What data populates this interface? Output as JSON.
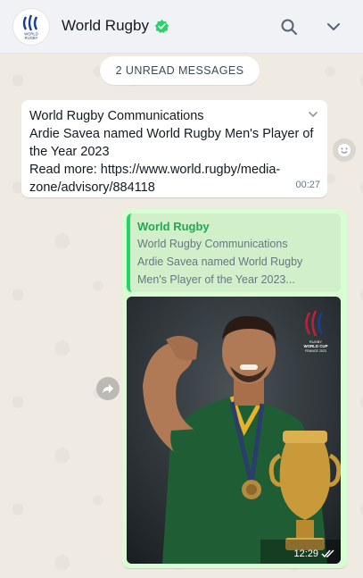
{
  "header": {
    "contact_name": "World Rugby",
    "avatar_text_top": "WORLD",
    "avatar_text_bottom": "RUGBY",
    "icons": [
      "verified-check-icon",
      "search-icon",
      "chevron-down-icon"
    ]
  },
  "chat": {
    "unread_label": "2 UNREAD MESSAGES",
    "incoming": {
      "lines": [
        "World Rugby Communications",
        "Ardie Savea named World Rugby Men's Player of",
        "the Year 2023",
        "Read more: https://www.world.rugby/media-",
        "zone/advisory/884118"
      ],
      "time": "00:27"
    },
    "outgoing": {
      "quote_author": "World Rugby",
      "quote_lines": [
        "World Rugby Communications",
        "Ardie Savea named World Rugby",
        "Men's Player of the Year 2023..."
      ],
      "photo_logo_top": "RUGBY",
      "photo_logo_mid": "WORLD CUP",
      "photo_logo_bottom": "FRANCE 2023",
      "time": "12:29"
    }
  },
  "colors": {
    "accent_green": "#25d366",
    "verified_green": "#25d366",
    "outgoing_bubble": "#d9fdd3",
    "chat_background": "#efeae2"
  }
}
